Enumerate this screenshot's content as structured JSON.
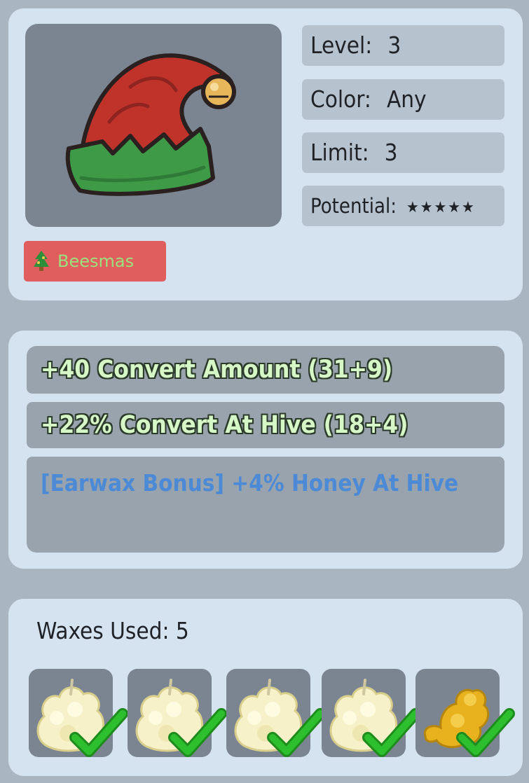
{
  "item": {
    "name_icon": "elf-hat-icon",
    "stats": {
      "level_label": "Level:",
      "level_value": "3",
      "color_label": "Color:",
      "color_value": "Any",
      "limit_label": "Limit:",
      "limit_value": "3",
      "potential_label": "Potential:",
      "potential_value": "★★★★★"
    },
    "tag": {
      "label": "Beesmas",
      "icon": "christmas-tree-icon"
    }
  },
  "bonuses": [
    {
      "text": "+40 Convert Amount (31+9)"
    },
    {
      "text": "+22% Convert At Hive (18+4)"
    },
    {
      "text": "[Earwax Bonus] +4% Honey At Hive"
    }
  ],
  "waxes": {
    "title": "Waxes Used: 5",
    "slots": [
      {
        "icon": "soft-wax-icon",
        "status": "check-icon"
      },
      {
        "icon": "soft-wax-icon",
        "status": "check-icon"
      },
      {
        "icon": "soft-wax-icon",
        "status": "check-icon"
      },
      {
        "icon": "soft-wax-icon",
        "status": "check-icon"
      },
      {
        "icon": "caustic-wax-icon",
        "status": "check-icon"
      }
    ]
  },
  "colors": {
    "card_bg": "#d4e3ef",
    "page_bg": "#a9b6c2",
    "tag_bg": "#e05e5e",
    "bonus_text": "#d6f7c6",
    "earwax_text": "#4c8ad6",
    "check": "#2dbf2d"
  }
}
